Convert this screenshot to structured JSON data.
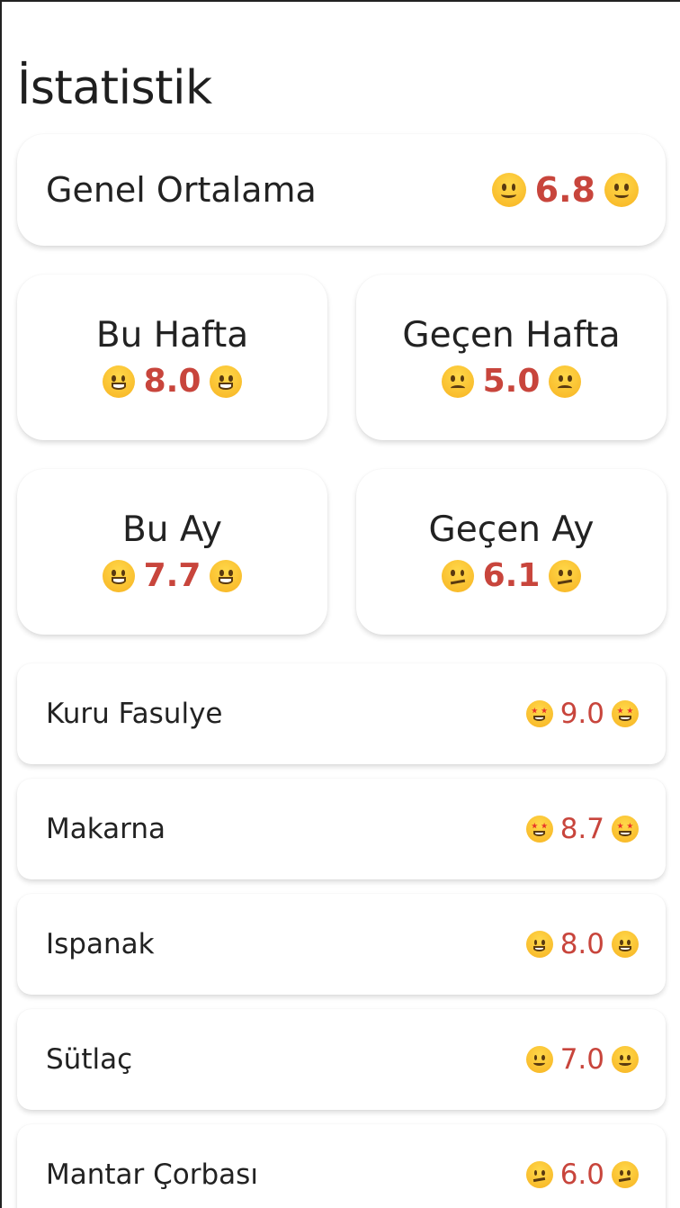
{
  "page": {
    "title": "İstatistik"
  },
  "overall": {
    "label": "Genel Ortalama",
    "score": "6.8",
    "emoji": "slightly-smiling-face-icon"
  },
  "periods": [
    {
      "label": "Bu Hafta",
      "score": "8.0",
      "emoji": "grinning-face-icon"
    },
    {
      "label": "Geçen Hafta",
      "score": "5.0",
      "emoji": "frowning-face-icon"
    },
    {
      "label": "Bu Ay",
      "score": "7.7",
      "emoji": "grinning-face-icon"
    },
    {
      "label": "Geçen Ay",
      "score": "6.1",
      "emoji": "confused-face-icon"
    }
  ],
  "foods": [
    {
      "label": "Kuru Fasulye",
      "score": "9.0",
      "emoji": "star-struck-icon"
    },
    {
      "label": "Makarna",
      "score": "8.7",
      "emoji": "star-struck-icon"
    },
    {
      "label": "Ispanak",
      "score": "8.0",
      "emoji": "grinning-face-icon"
    },
    {
      "label": "Sütlaç",
      "score": "7.0",
      "emoji": "slightly-smiling-face-icon"
    },
    {
      "label": "Mantar Çorbası",
      "score": "6.0",
      "emoji": "confused-face-icon"
    }
  ],
  "colors": {
    "score": "#c8453c",
    "text": "#222222",
    "card_bg": "#ffffff"
  }
}
